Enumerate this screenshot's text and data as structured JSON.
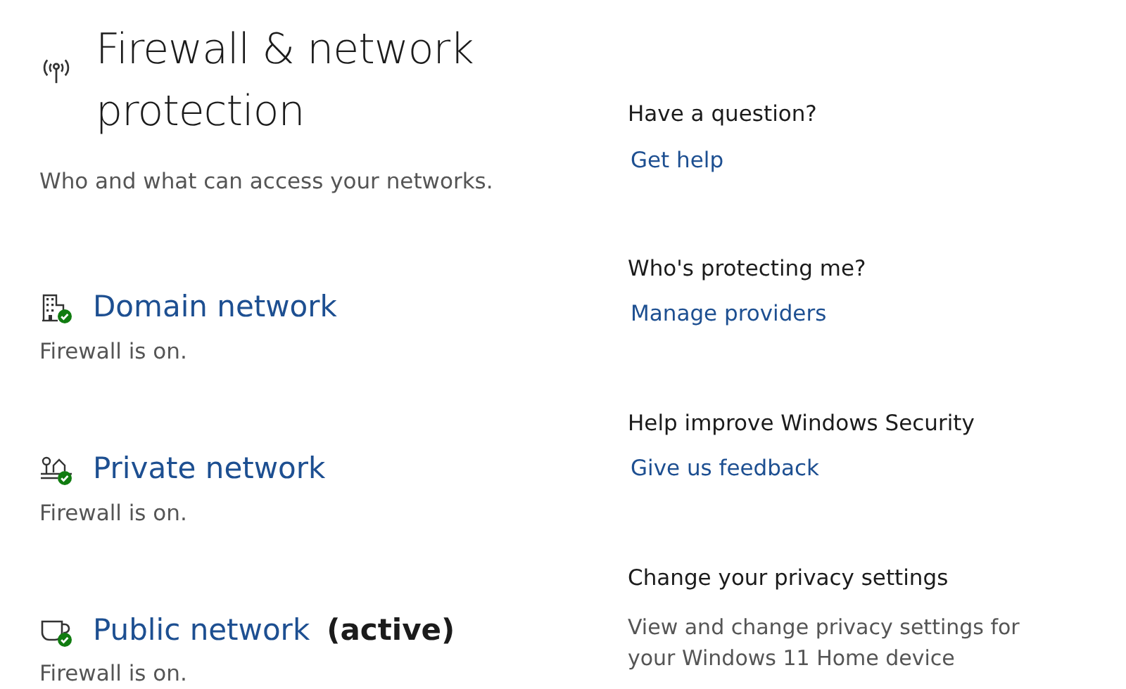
{
  "page": {
    "title": "Firewall & network protection",
    "subtitle": "Who and what can access your networks."
  },
  "networks": [
    {
      "kind": "domain",
      "name": "Domain network",
      "status": "Firewall is on."
    },
    {
      "kind": "private",
      "name": "Private network",
      "status": "Firewall is on."
    },
    {
      "kind": "public",
      "name": "Public network",
      "tag": "(active)",
      "status": "Firewall is on."
    }
  ],
  "side_sections": [
    {
      "heading": "Have a question?",
      "link": "Get help"
    },
    {
      "heading": "Who's protecting me?",
      "link": "Manage providers"
    },
    {
      "heading": "Help improve Windows Security",
      "link": "Give us feedback"
    },
    {
      "heading": "Change your privacy settings",
      "text": "View and change privacy settings for your Windows 11 Home device"
    }
  ]
}
